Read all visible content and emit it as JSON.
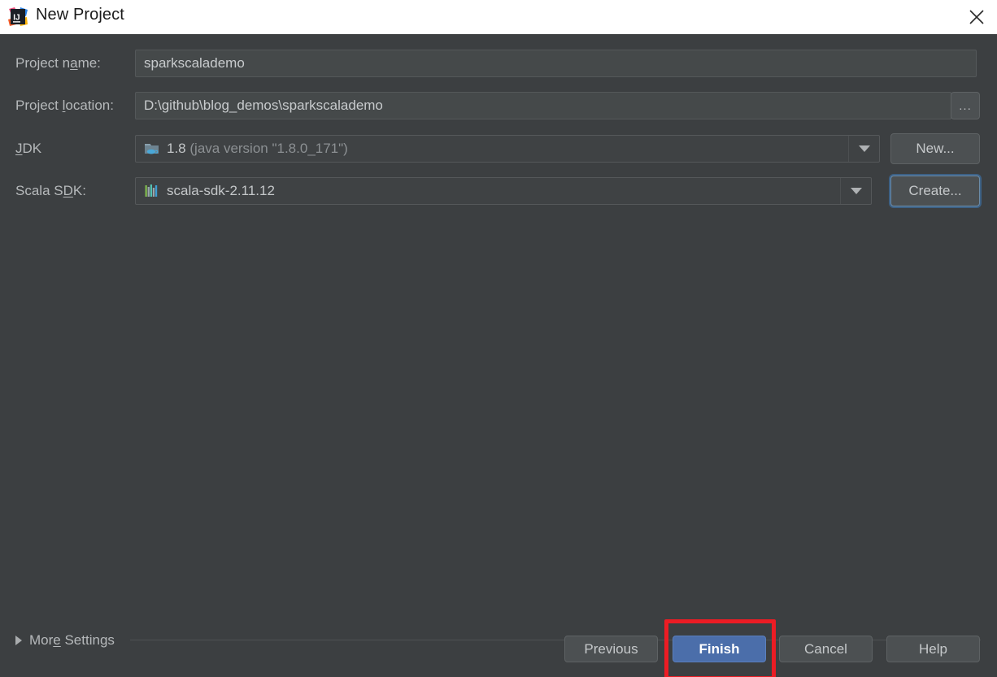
{
  "window": {
    "title": "New Project",
    "app_icon": "intellij-idea-logo",
    "close_icon": "close-icon"
  },
  "form": {
    "fields": [
      {
        "id": "project-name",
        "label_pre": "Project n",
        "label_mnemonic": "a",
        "label_post": "me:",
        "label_full": "Project name:",
        "value": "sparkscalademo",
        "type": "text"
      },
      {
        "id": "project-location",
        "label_pre": "Project ",
        "label_mnemonic": "l",
        "label_post": "ocation:",
        "label_full": "Project location:",
        "value": "D:\\github\\blog_demos\\sparkscalademo",
        "type": "text",
        "browse_button": "..."
      },
      {
        "id": "jdk",
        "label_pre": "",
        "label_mnemonic": "J",
        "label_post": "DK",
        "label_full": "JDK",
        "value": "1.8",
        "value_detail": "(java version \"1.8.0_171\")",
        "icon": "jdk-folder-icon",
        "type": "combo",
        "side_button": "New..."
      },
      {
        "id": "scala-sdk",
        "label_pre": "Scala S",
        "label_mnemonic": "D",
        "label_post": "K:",
        "label_full": "Scala SDK:",
        "value": "scala-sdk-2.11.12",
        "icon": "scala-sdk-icon",
        "type": "combo",
        "side_button": "Create..."
      }
    ]
  },
  "more_settings": {
    "label_pre": "Mor",
    "label_mnemonic": "e",
    "label_post": " Settings",
    "label_full": "More Settings",
    "expanded": false,
    "triangle_icon": "chevron-right-icon"
  },
  "footer": {
    "previous_label": "Previous",
    "finish_label": "Finish",
    "cancel_label": "Cancel",
    "help_label": "Help"
  },
  "colors": {
    "dialog_background": "#3c3f41",
    "titlebar_background": "#ffffff",
    "input_background": "#45494a",
    "button_background": "#4c5052",
    "default_button_blue": "#4b6eaa",
    "focus_ring_blue": "#3d6185",
    "annotation_red": "#ec1c24",
    "text_primary": "#b6b9bb",
    "text_dim": "#8c9093"
  }
}
